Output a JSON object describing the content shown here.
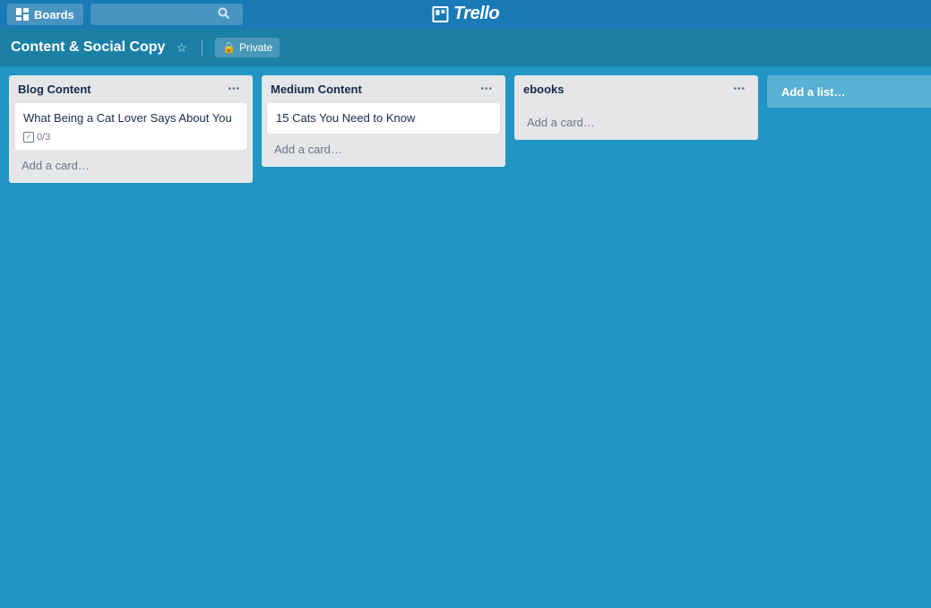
{
  "nav": {
    "boards_label": "Boards",
    "search_placeholder": "",
    "trello_label": "Trello"
  },
  "board": {
    "title": "Content & Social Copy",
    "privacy_label": "Private"
  },
  "lists": [
    {
      "id": "blog-content",
      "title": "Blog Content",
      "cards": [
        {
          "id": "card-1",
          "title": "What Being a Cat Lover Says About You",
          "badges": {
            "checklist": "0/3"
          }
        }
      ],
      "add_card_label": "Add a card…"
    },
    {
      "id": "medium-content",
      "title": "Medium Content",
      "cards": [
        {
          "id": "card-2",
          "title": "15 Cats You Need to Know",
          "badges": null
        }
      ],
      "add_card_label": "Add a card…"
    },
    {
      "id": "ebooks",
      "title": "ebooks",
      "cards": [],
      "add_card_label": "Add a card…"
    }
  ],
  "add_list": {
    "label": "Add a list…"
  }
}
